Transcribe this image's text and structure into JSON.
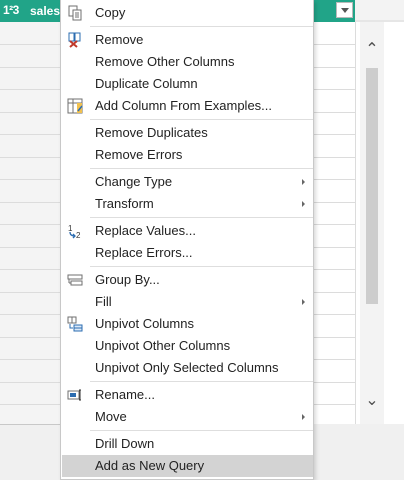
{
  "column": {
    "type_label": "1²3",
    "name": "sales"
  },
  "scroll": {
    "up_glyph": "⌃",
    "down_glyph": "⌄"
  },
  "menu": {
    "items": [
      {
        "id": "copy",
        "label": "Copy",
        "icon": "copy-icon"
      },
      {
        "id": "remove",
        "label": "Remove",
        "icon": "remove-column-icon"
      },
      {
        "id": "remove-other-columns",
        "label": "Remove Other Columns"
      },
      {
        "id": "duplicate-column",
        "label": "Duplicate Column"
      },
      {
        "id": "add-column-from-examples",
        "label": "Add Column From Examples...",
        "icon": "column-from-examples-icon"
      },
      {
        "id": "remove-duplicates",
        "label": "Remove Duplicates"
      },
      {
        "id": "remove-errors",
        "label": "Remove Errors"
      },
      {
        "id": "change-type",
        "label": "Change Type",
        "submenu": true
      },
      {
        "id": "transform",
        "label": "Transform",
        "submenu": true
      },
      {
        "id": "replace-values",
        "label": "Replace Values...",
        "icon": "replace-values-icon"
      },
      {
        "id": "replace-errors",
        "label": "Replace Errors..."
      },
      {
        "id": "group-by",
        "label": "Group By...",
        "icon": "group-by-icon"
      },
      {
        "id": "fill",
        "label": "Fill",
        "submenu": true
      },
      {
        "id": "unpivot-columns",
        "label": "Unpivot Columns",
        "icon": "unpivot-icon"
      },
      {
        "id": "unpivot-other-columns",
        "label": "Unpivot Other Columns"
      },
      {
        "id": "unpivot-only-selected-columns",
        "label": "Unpivot Only Selected Columns"
      },
      {
        "id": "rename",
        "label": "Rename...",
        "icon": "rename-icon"
      },
      {
        "id": "move",
        "label": "Move",
        "submenu": true
      },
      {
        "id": "drill-down",
        "label": "Drill Down"
      },
      {
        "id": "add-as-new-query",
        "label": "Add as New Query",
        "hovered": true
      }
    ]
  },
  "colors": {
    "column_header": "#21a488",
    "menu_hover": "#d3d3d3",
    "icon_blue": "#2b6cb0",
    "icon_red": "#c0392b"
  }
}
